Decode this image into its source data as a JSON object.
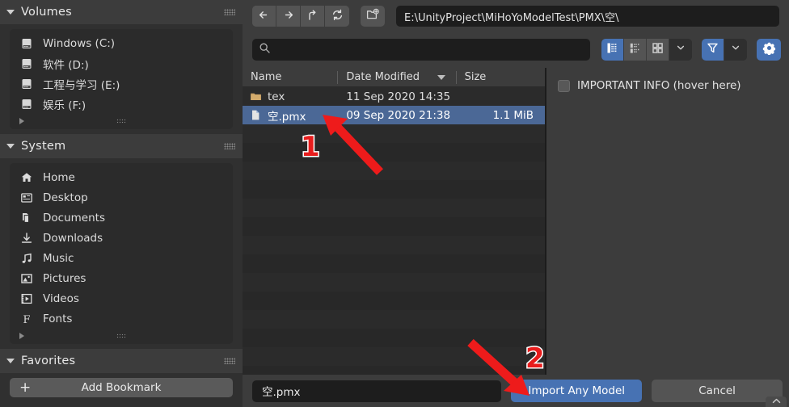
{
  "sidebar": {
    "sections": [
      {
        "title": "Volumes",
        "items": [
          {
            "label": "Windows (C:)",
            "icon": "disk-icon"
          },
          {
            "label": "软件 (D:)",
            "icon": "disk-icon"
          },
          {
            "label": "工程与学习 (E:)",
            "icon": "disk-icon"
          },
          {
            "label": "娱乐 (F:)",
            "icon": "disk-icon"
          }
        ]
      },
      {
        "title": "System",
        "items": [
          {
            "label": "Home",
            "icon": "home-icon"
          },
          {
            "label": "Desktop",
            "icon": "desktop-icon"
          },
          {
            "label": "Documents",
            "icon": "documents-icon"
          },
          {
            "label": "Downloads",
            "icon": "download-icon"
          },
          {
            "label": "Music",
            "icon": "music-note-icon"
          },
          {
            "label": "Pictures",
            "icon": "picture-icon"
          },
          {
            "label": "Videos",
            "icon": "film-icon"
          },
          {
            "label": "Fonts",
            "icon": "font-f-icon"
          }
        ]
      },
      {
        "title": "Favorites",
        "items": []
      }
    ],
    "add_bookmark_label": "Add Bookmark"
  },
  "topbar": {
    "back_icon": "arrow-left-icon",
    "forward_icon": "arrow-right-icon",
    "up_icon": "arrow-up-parent-icon",
    "refresh_icon": "refresh-icon",
    "new_folder_icon": "new-folder-icon",
    "path_value": "E:\\UnityProject\\MiHoYoModelTest\\PMX\\空\\"
  },
  "searchbar": {
    "search_icon": "search-icon",
    "search_value": "",
    "search_placeholder": "",
    "view_modes": [
      {
        "name": "vertical-list",
        "icon": "list-vertical-icon",
        "active": true
      },
      {
        "name": "horizontal-list",
        "icon": "list-horizontal-icon",
        "active": false
      },
      {
        "name": "thumbnails",
        "icon": "grid-thumbnails-icon",
        "active": false
      }
    ],
    "display_dropdown_icon": "chevron-down-icon",
    "filter_icon": "funnel-filter-icon",
    "filter_dropdown_icon": "chevron-down-icon",
    "settings_icon": "gear-icon"
  },
  "filelist": {
    "columns": [
      {
        "label": "Name",
        "sorted": false
      },
      {
        "label": "Date Modified",
        "sorted": true
      },
      {
        "label": "Size",
        "sorted": false
      }
    ],
    "sort_arrow_icon": "sort-descending-arrow-icon",
    "rows": [
      {
        "name": "tex",
        "date": "11 Sep 2020 14:35",
        "size": "",
        "icon": "folder-icon",
        "selected": false
      },
      {
        "name": "空.pmx",
        "date": "09 Sep 2020 21:38",
        "size": "1.1 MiB",
        "icon": "file-icon",
        "selected": true
      }
    ],
    "empty_row_count": 14
  },
  "options": {
    "important_info": {
      "label": "IMPORTANT INFO (hover here)",
      "checked": false
    }
  },
  "bottombar": {
    "filename_value": "空.pmx",
    "import_button_label": "Import Any Model",
    "cancel_button_label": "Cancel",
    "corner_icon": "chevron-up-icon"
  },
  "annotations": [
    {
      "id": "marker-1",
      "label": "1"
    },
    {
      "id": "marker-2",
      "label": "2"
    }
  ],
  "colors": {
    "accent_blue": "#4772b3",
    "selection_blue": "#4b6896",
    "annotation_red": "#e81d1d",
    "panel_bg": "#3c3c3c",
    "list_bg": "#2b2b2b",
    "field_bg": "#1d1d1d"
  }
}
